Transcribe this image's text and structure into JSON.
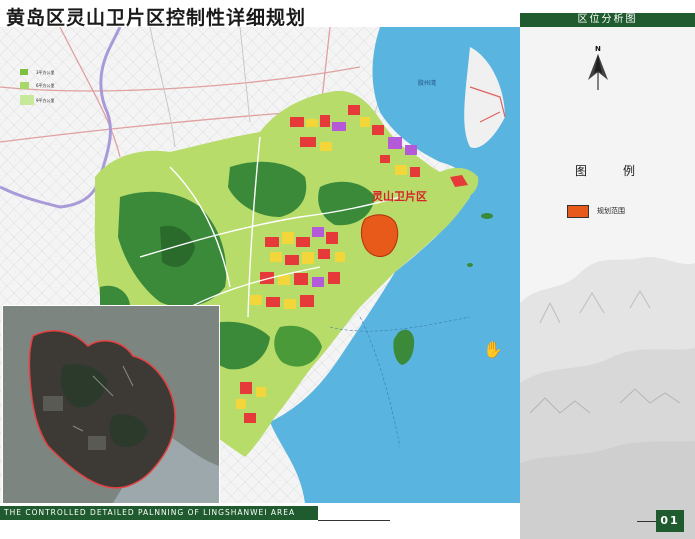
{
  "title": "黄岛区灵山卫片区控制性详细规划",
  "footer_subtitle": "THE CONTROLLED DETAILED PALNNING OF LINGSHANWEI AREA",
  "page_number": "01",
  "panel": {
    "header": "区位分析图",
    "north_label": "N",
    "legend_title": "图例",
    "legend_items": [
      {
        "label": "规划范围",
        "color": "#e85a1a"
      }
    ]
  },
  "map": {
    "site_label": "灵山卫片区",
    "sea_label": "胶州湾",
    "key_items": [
      {
        "label": "3平方公里",
        "color": "#7fbf3f"
      },
      {
        "label": "6平方公里",
        "color": "#a8d86a"
      },
      {
        "label": "9平方公里",
        "color": "#c8e89a"
      }
    ],
    "colors": {
      "sea": "#5ab4e0",
      "land": "#b7dc6a",
      "forest": "#3a8a3a",
      "urban_red": "#e63a3a",
      "urban_yellow": "#f2d63a",
      "urban_purple": "#b45ad8",
      "site": "#e85a1a",
      "boundary": "#a89ad8"
    }
  },
  "cursor_icon": "hand-cursor-icon"
}
